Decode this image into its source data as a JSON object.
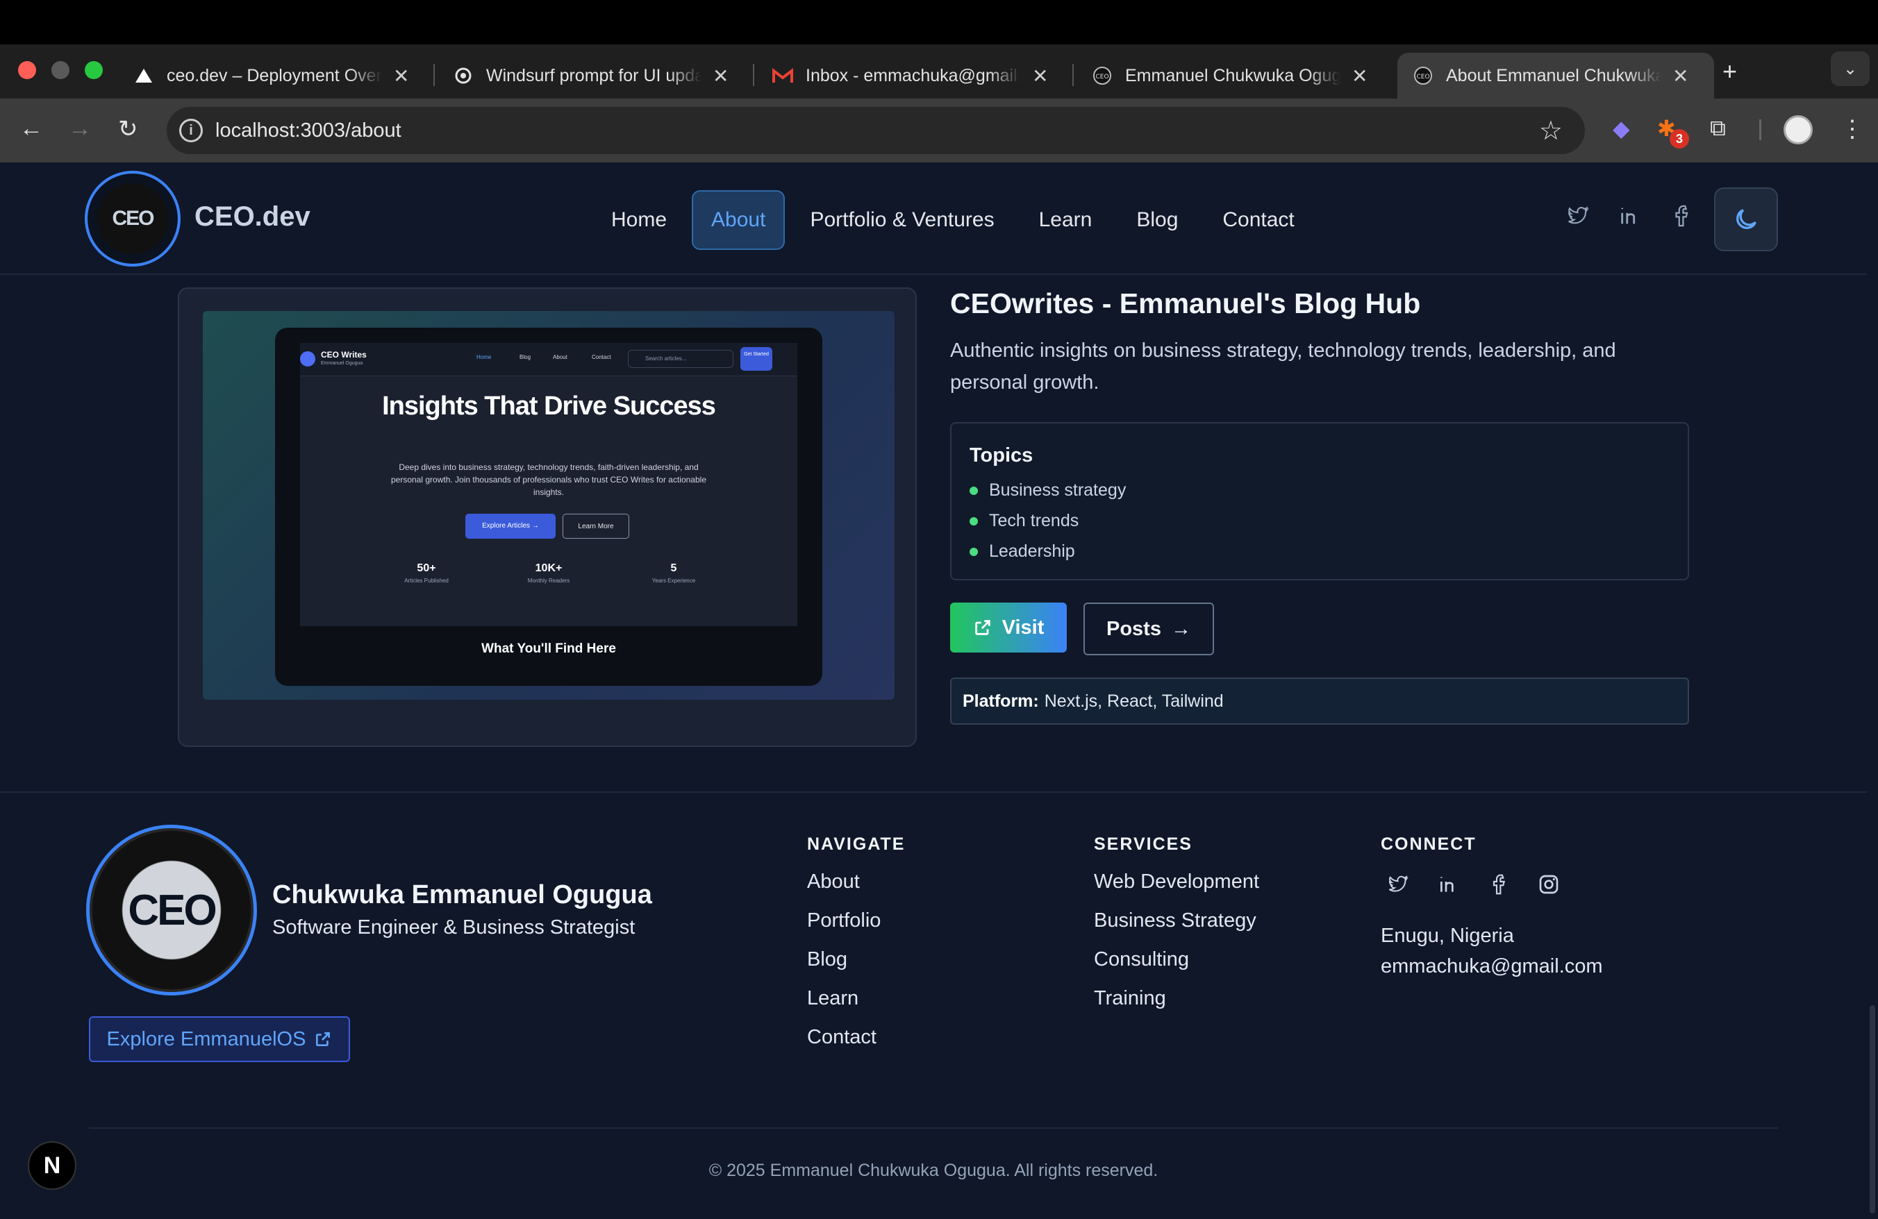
{
  "browser": {
    "tabs": [
      {
        "title": "ceo.dev – Deployment Overview"
      },
      {
        "title": "Windsurf prompt for UI updates"
      },
      {
        "title": "Inbox - emmachuka@gmail.com"
      },
      {
        "title": "Emmanuel Chukwuka Ogugua"
      },
      {
        "title": "About Emmanuel Chukwuka Ogugua"
      }
    ],
    "close_glyph": "✕",
    "new_tab": "+",
    "url": "localhost:3003/about",
    "extension_badge": "3"
  },
  "header": {
    "logo_text": "CEO",
    "brand": "CEO.dev",
    "nav": [
      "Home",
      "About",
      "Portfolio & Ventures",
      "Learn",
      "Blog",
      "Contact"
    ],
    "active_nav": "About"
  },
  "project": {
    "title": "CEOwrites - Emmanuel's Blog Hub",
    "description": "Authentic insights on business strategy, technology trends, leadership, and personal growth.",
    "topics_heading": "Topics",
    "topics": [
      "Business strategy",
      "Tech trends",
      "Leadership"
    ],
    "visit_label": "Visit",
    "posts_label": "Posts",
    "platform_label": "Platform:",
    "platform_value": "Next.js, React, Tailwind",
    "preview": {
      "brand": "CEO Writes",
      "brand_sub": "Emmanuel Ogugua",
      "nav": [
        "Home",
        "Blog",
        "About",
        "Contact"
      ],
      "search_placeholder": "Search articles...",
      "get_started": "Get Started",
      "headline": "Insights That Drive Success",
      "body": "Deep dives into business strategy, technology trends, faith-driven leadership, and personal growth. Join thousands of professionals who trust CEO Writes for actionable insights.",
      "btn_primary": "Explore Articles →",
      "btn_secondary": "Learn More",
      "stats": [
        {
          "value": "50+",
          "label": "Articles Published"
        },
        {
          "value": "10K+",
          "label": "Monthly Readers"
        },
        {
          "value": "5",
          "label": "Years Experience"
        }
      ],
      "footer_heading": "What You'll Find Here"
    }
  },
  "footer": {
    "logo_text": "CEO",
    "name": "Chukwuka Emmanuel Ogugua",
    "role": "Software Engineer & Business Strategist",
    "explore_label": "Explore EmmanuelOS",
    "navigate_heading": "NAVIGATE",
    "navigate_links": [
      "About",
      "Portfolio",
      "Blog",
      "Learn",
      "Contact"
    ],
    "services_heading": "SERVICES",
    "services_links": [
      "Web Development",
      "Business Strategy",
      "Consulting",
      "Training"
    ],
    "connect_heading": "CONNECT",
    "location": "Enugu, Nigeria",
    "email": "emmachuka@gmail.com",
    "copyright": "© 2025 Emmanuel Chukwuka Ogugua. All rights reserved."
  },
  "dev_badge": "N",
  "colors": {
    "accent": "#60a5fa",
    "background": "#0f1729",
    "topic_bullet": "#4ade80"
  }
}
